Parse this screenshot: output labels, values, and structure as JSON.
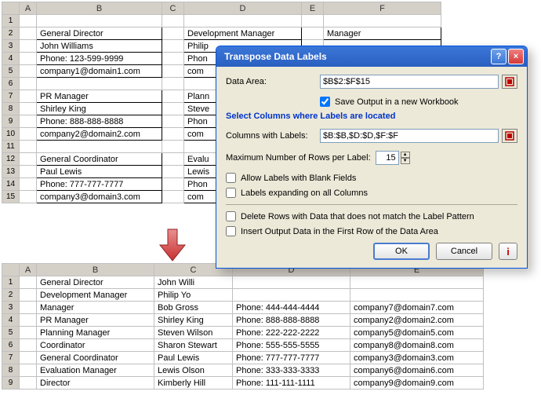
{
  "dialog": {
    "title": "Transpose Data Labels",
    "data_area_label": "Data Area:",
    "data_area_value": "$B$2:$F$15",
    "save_new_wb": "Save Output in a new Workbook",
    "section_link": "Select Columns where Labels are located",
    "cols_label": "Columns with Labels:",
    "cols_value": "$B:$B,$D:$D,$F:$F",
    "max_rows_label": "Maximum Number of Rows per Label:",
    "max_rows_value": "15",
    "allow_blank": "Allow Labels with Blank Fields",
    "expand_cols": "Labels expanding on all Columns",
    "delete_rows": "Delete Rows with Data that does not match the Label Pattern",
    "insert_first": "Insert Output Data in the First Row of the Data Area",
    "ok": "OK",
    "cancel": "Cancel",
    "info": "i"
  },
  "sheet1": {
    "cols": [
      "A",
      "B",
      "C",
      "D",
      "E",
      "F"
    ],
    "rows": {
      "1": [
        "",
        "",
        "",
        "",
        "",
        ""
      ],
      "2": [
        "",
        "General Director",
        "",
        "Development Manager",
        "",
        "Manager"
      ],
      "3": [
        "",
        "John Williams",
        "",
        "Philip",
        "",
        ""
      ],
      "4": [
        "",
        "Phone: 123-599-9999",
        "",
        "Phon",
        "",
        ""
      ],
      "5": [
        "",
        "company1@domain1.com",
        "",
        "com",
        "",
        ""
      ],
      "6": [
        "",
        "",
        "",
        "",
        "",
        ""
      ],
      "7": [
        "",
        "PR Manager",
        "",
        "Plann",
        "",
        ""
      ],
      "8": [
        "",
        "Shirley King",
        "",
        "Steve",
        "",
        ""
      ],
      "9": [
        "",
        "Phone: 888-888-8888",
        "",
        "Phon",
        "",
        ""
      ],
      "10": [
        "",
        "company2@domain2.com",
        "",
        "com",
        "",
        ""
      ],
      "11": [
        "",
        "",
        "",
        "",
        "",
        ""
      ],
      "12": [
        "",
        "General Coordinator",
        "",
        "Evalu",
        "",
        ""
      ],
      "13": [
        "",
        "Paul Lewis",
        "",
        "Lewis",
        "",
        ""
      ],
      "14": [
        "",
        "Phone: 777-777-7777",
        "",
        "Phon",
        "",
        ""
      ],
      "15": [
        "",
        "company3@domain3.com",
        "",
        "com",
        "",
        ""
      ]
    }
  },
  "sheet2": {
    "cols": [
      "A",
      "B",
      "C",
      "D",
      "E"
    ],
    "rows": [
      [
        "1",
        "General Director",
        "John Willi",
        "",
        ""
      ],
      [
        "2",
        "Development Manager",
        "Philip Yo",
        "",
        ""
      ],
      [
        "3",
        "Manager",
        "Bob Gross",
        "Phone: 444-444-4444",
        "company7@domain7.com"
      ],
      [
        "4",
        "PR Manager",
        "Shirley King",
        "Phone: 888-888-8888",
        "company2@domain2.com"
      ],
      [
        "5",
        "Planning Manager",
        "Steven Wilson",
        "Phone: 222-222-2222",
        "company5@domain5.com"
      ],
      [
        "6",
        "Coordinator",
        "Sharon Stewart",
        "Phone: 555-555-5555",
        "company8@domain8.com"
      ],
      [
        "7",
        "General Coordinator",
        "Paul Lewis",
        "Phone: 777-777-7777",
        "company3@domain3.com"
      ],
      [
        "8",
        "Evaluation Manager",
        "Lewis Olson",
        "Phone: 333-333-3333",
        "company6@domain6.com"
      ],
      [
        "9",
        "Director",
        "Kimberly Hill",
        "Phone: 111-111-1111",
        "company9@domain9.com"
      ]
    ]
  }
}
